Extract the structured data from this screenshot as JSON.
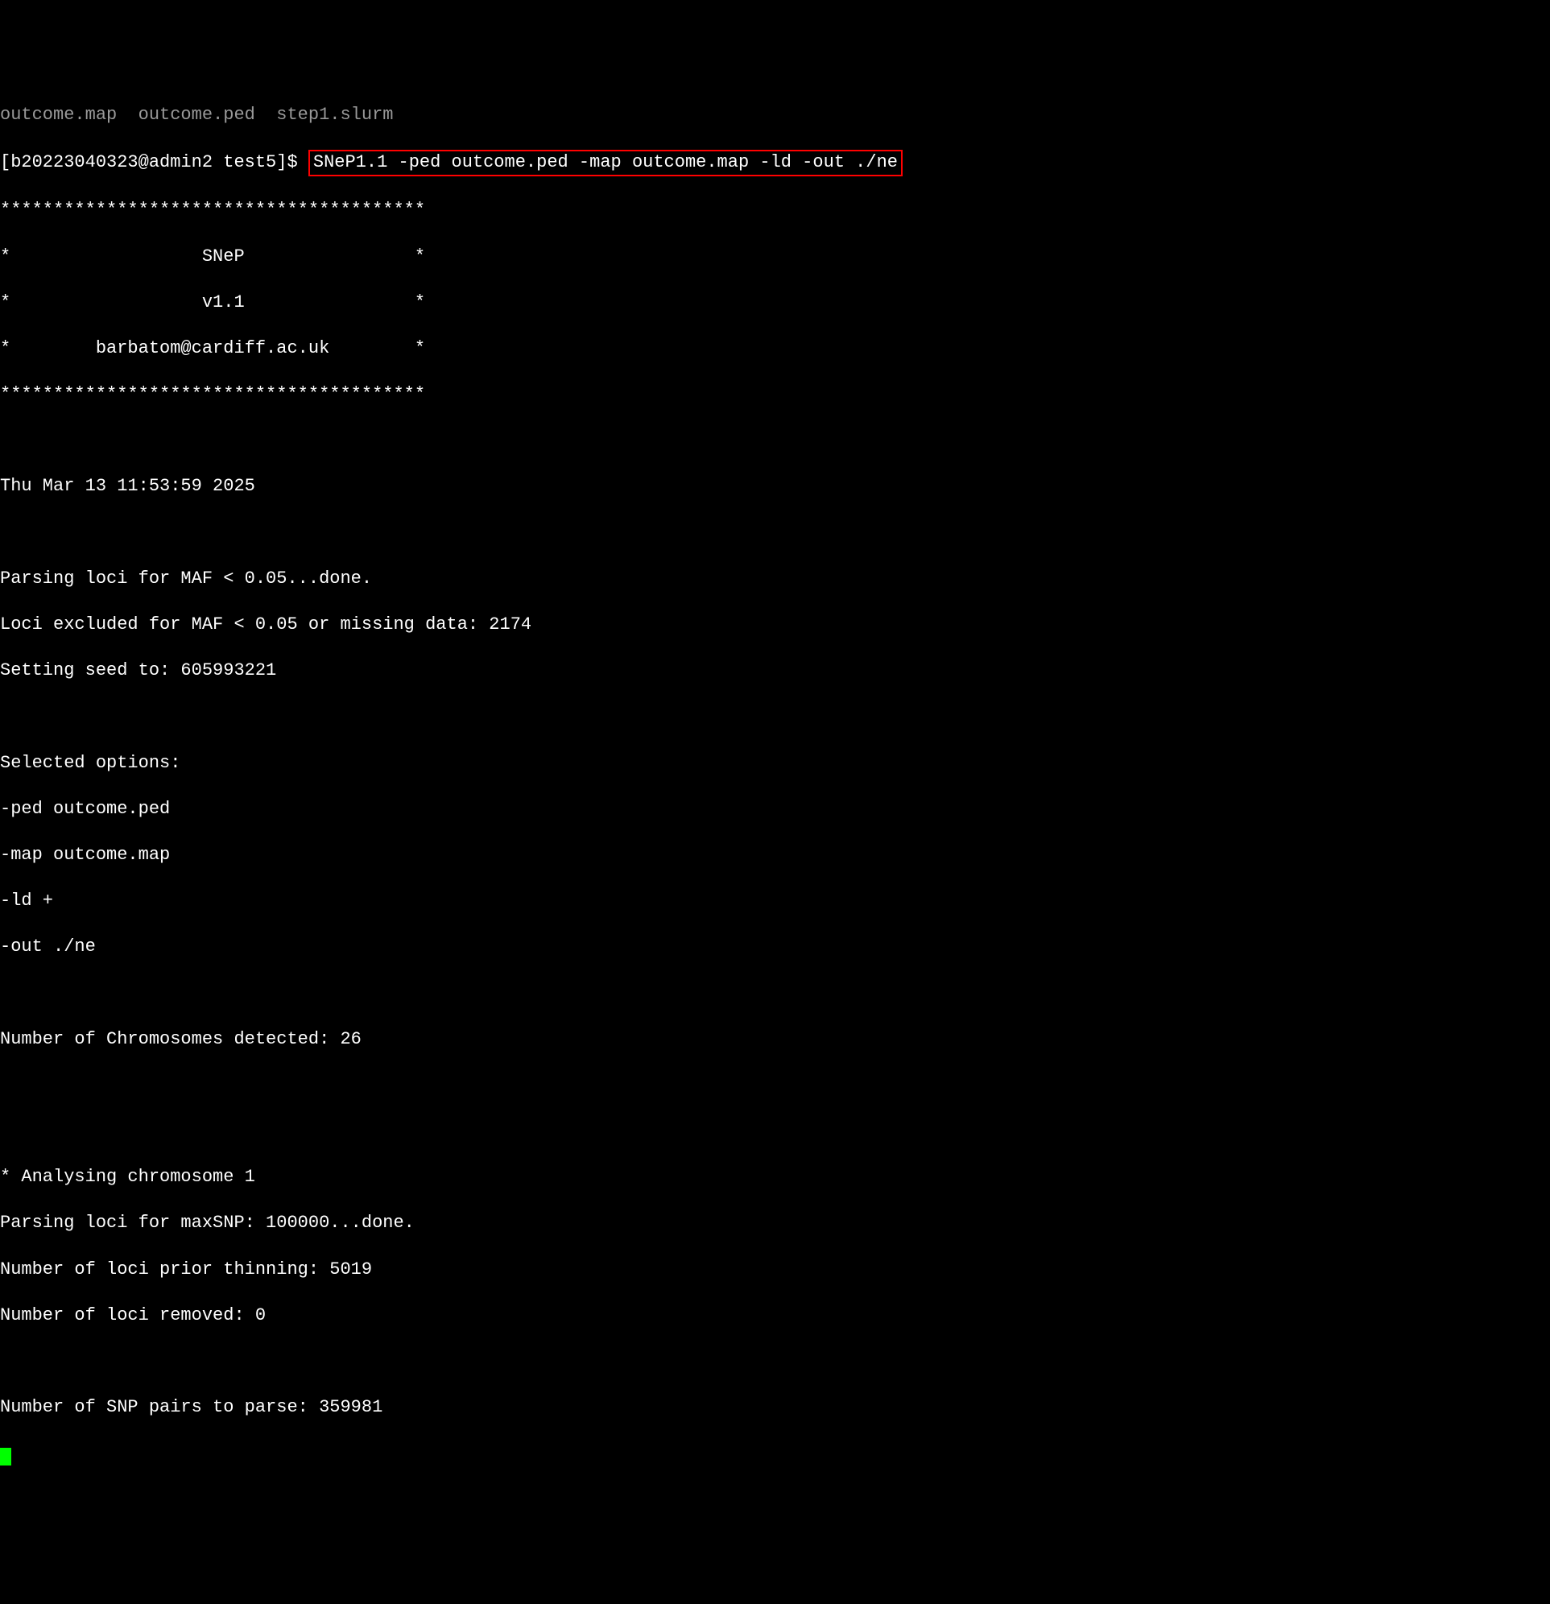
{
  "partial_top_line": "outcome.map  outcome.ped  step1.slurm",
  "prompt": "[b20223040323@admin2 test5]$ ",
  "command": "SNeP1.1 -ped outcome.ped -map outcome.map -ld -out ./ne",
  "banner_top": "****************************************",
  "banner_name": "*                  SNeP                *",
  "banner_version": "*                  v1.1                *",
  "banner_email": "*        barbatom@cardiff.ac.uk        *",
  "banner_bottom": "****************************************",
  "timestamp": "Thu Mar 13 11:53:59 2025",
  "parsing_maf": "Parsing loci for MAF < 0.05...done.",
  "loci_excluded": "Loci excluded for MAF < 0.05 or missing data: 2174",
  "seed": "Setting seed to: 605993221",
  "selected_options_header": "Selected options:",
  "opt_ped": "-ped outcome.ped",
  "opt_map": "-map outcome.map",
  "opt_ld": "-ld +",
  "opt_out": "-out ./ne",
  "chromosomes": "Number of Chromosomes detected: 26",
  "analysing": "* Analysing chromosome 1",
  "parsing_maxsnp": "Parsing loci for maxSNP: 100000...done.",
  "loci_prior": "Number of loci prior thinning: 5019",
  "loci_removed": "Number of loci removed: 0",
  "snp_pairs": "Number of SNP pairs to parse: 359981"
}
